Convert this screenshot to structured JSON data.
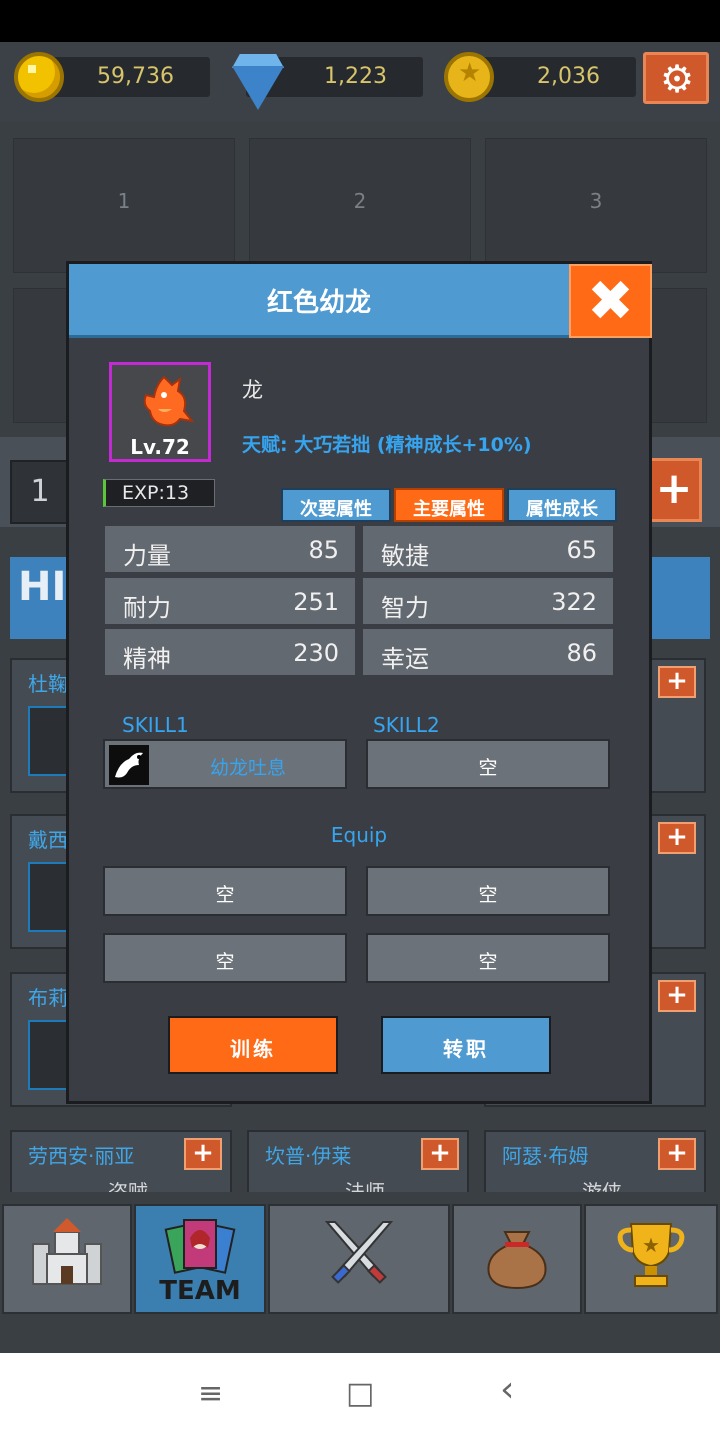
{
  "currencies": [
    {
      "icon": "gold-coin-icon",
      "value": "59,736"
    },
    {
      "icon": "diamond-icon",
      "value": "1,223"
    },
    {
      "icon": "medal-icon",
      "value": "2,036"
    }
  ],
  "settings_icon": "⚙",
  "team_slots": [
    "1",
    "2",
    "3"
  ],
  "background": {
    "slot_number": "1",
    "plus": "+",
    "heading": "HI",
    "hero_cards": [
      {
        "name": "杜鞠",
        "plus": "+"
      },
      {
        "name": "戴西",
        "plus": "+"
      },
      {
        "name": "布莉",
        "plus": "+"
      }
    ],
    "bottom_cards": [
      {
        "name": "劳西安·丽亚",
        "class": "盗贼",
        "plus": "+"
      },
      {
        "name": "坎普·伊莱",
        "class": "法师",
        "plus": "+"
      },
      {
        "name": "阿瑟·布姆",
        "class": "游侠",
        "plus": "+"
      }
    ]
  },
  "tabs": [
    {
      "icon": "castle-icon",
      "label": ""
    },
    {
      "icon": "team-card-icon",
      "label": "TEAM"
    },
    {
      "icon": "crossed-swords-icon",
      "label": ""
    },
    {
      "icon": "loot-bag-icon",
      "label": ""
    },
    {
      "icon": "trophy-icon",
      "label": ""
    }
  ],
  "dialog": {
    "title": "红色幼龙",
    "close": "✖",
    "level": "Lv.72",
    "race": "龙",
    "talent": "天赋: 大巧若拙 (精神成长+10%)",
    "exp": "EXP:13",
    "attr_tabs": [
      "次要属性",
      "主要属性",
      "属性成长"
    ],
    "active_tab": "主要属性",
    "stats": [
      {
        "label": "力量",
        "value": "85"
      },
      {
        "label": "敏捷",
        "value": "65"
      },
      {
        "label": "耐力",
        "value": "251"
      },
      {
        "label": "智力",
        "value": "322"
      },
      {
        "label": "精神",
        "value": "230"
      },
      {
        "label": "幸运",
        "value": "86"
      }
    ],
    "skill1_label": "SKILL1",
    "skill2_label": "SKILL2",
    "skill1": "幼龙吐息",
    "skill2": "空",
    "equip_label": "Equip",
    "equip": [
      "空",
      "空",
      "空",
      "空"
    ],
    "train_label": "训练",
    "job_label": "转职"
  },
  "system_nav": {
    "menu": "≡",
    "home": "□",
    "back": "‹"
  },
  "colors": {
    "accent_blue": "#4f9ad0",
    "accent_orange": "#ff6a16",
    "link_blue": "#36a4ef"
  }
}
